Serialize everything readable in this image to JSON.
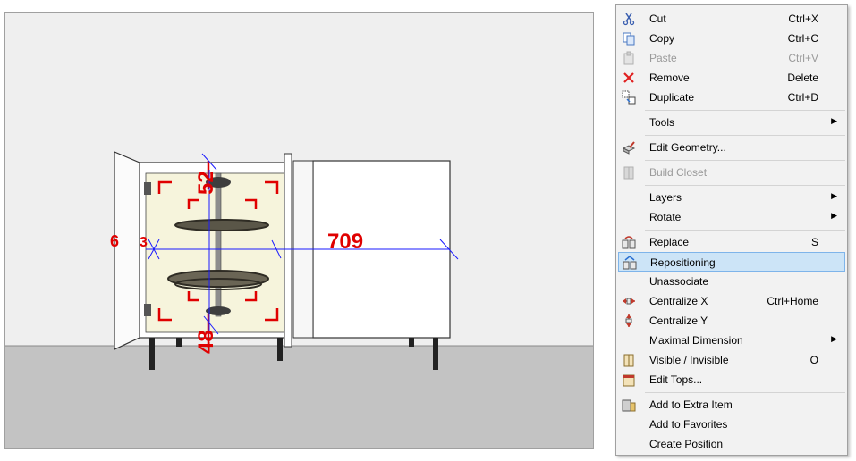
{
  "viewport": {
    "dimensions": {
      "d1": "52",
      "d2": "709",
      "d3": "48",
      "d4": "6",
      "d5": "3"
    }
  },
  "context_menu": {
    "items": [
      {
        "label": "Cut",
        "shortcut": "Ctrl+X",
        "icon": "scissors-icon",
        "disabled": false
      },
      {
        "label": "Copy",
        "shortcut": "Ctrl+C",
        "icon": "copy-icon",
        "disabled": false
      },
      {
        "label": "Paste",
        "shortcut": "Ctrl+V",
        "icon": "paste-icon",
        "disabled": true
      },
      {
        "label": "Remove",
        "shortcut": "Delete",
        "icon": "remove-x-icon",
        "disabled": false
      },
      {
        "label": "Duplicate",
        "shortcut": "Ctrl+D",
        "icon": "duplicate-icon",
        "disabled": false
      },
      {
        "label": "Tools",
        "submenu": true,
        "disabled": false
      },
      {
        "label": "Edit Geometry...",
        "icon": "edit-geometry-icon",
        "disabled": false
      },
      {
        "label": "Build Closet",
        "icon": "build-closet-icon",
        "disabled": true
      },
      {
        "label": "Layers",
        "submenu": true,
        "disabled": false
      },
      {
        "label": "Rotate",
        "submenu": true,
        "disabled": false
      },
      {
        "label": "Replace",
        "shortcut": "S",
        "icon": "replace-icon",
        "disabled": false
      },
      {
        "label": "Repositioning",
        "icon": "repositioning-icon",
        "disabled": false,
        "highlighted": true
      },
      {
        "label": "Unassociate",
        "disabled": false
      },
      {
        "label": "Centralize X",
        "shortcut": "Ctrl+Home",
        "icon": "centralize-x-icon",
        "disabled": false
      },
      {
        "label": "Centralize Y",
        "icon": "centralize-y-icon",
        "disabled": false
      },
      {
        "label": "Maximal Dimension",
        "submenu": true,
        "disabled": false
      },
      {
        "label": "Visible / Invisible",
        "shortcut": "O",
        "icon": "visible-icon",
        "disabled": false
      },
      {
        "label": "Edit Tops...",
        "icon": "edit-tops-icon",
        "disabled": false
      },
      {
        "label": "Add to Extra Item",
        "icon": "extra-item-icon",
        "disabled": false
      },
      {
        "label": "Add to Favorites",
        "disabled": false
      },
      {
        "label": "Create Position",
        "disabled": false
      }
    ],
    "submenu_arrow": "▶"
  }
}
